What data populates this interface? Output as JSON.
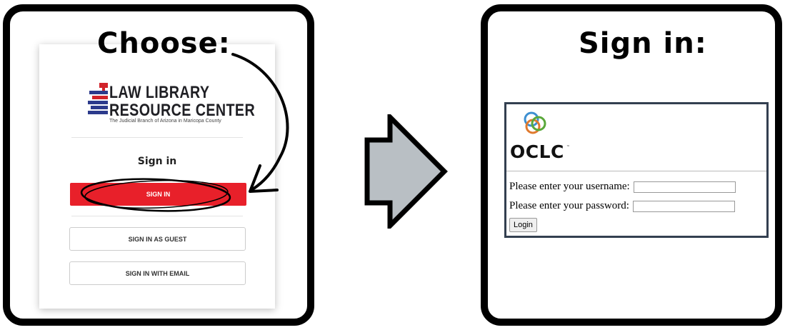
{
  "left_panel": {
    "heading": "Choose:",
    "logo": {
      "line1": "LAW LIBRARY",
      "line2": "RESOURCE CENTER",
      "subtitle": "The Judicial Branch of Arizona in Maricopa County"
    },
    "signin_label": "Sign in",
    "buttons": {
      "sign_in": "SIGN IN",
      "sign_in_guest": "SIGN IN AS GUEST",
      "sign_in_email": "SIGN IN WITH EMAIL"
    }
  },
  "right_panel": {
    "heading": "Sign in:",
    "oclc": {
      "brand": "OCLC",
      "tm": "™",
      "username_label": "Please enter your username:",
      "username_value": "",
      "password_label": "Please enter your password:",
      "password_value": "",
      "login_button": "Login"
    }
  },
  "colors": {
    "accent_red": "#e8202a",
    "arrow_fill": "#b9bfc4",
    "oclc_border": "#333f50",
    "logo_blue": "#2c3b8c",
    "logo_red": "#d1232a"
  }
}
